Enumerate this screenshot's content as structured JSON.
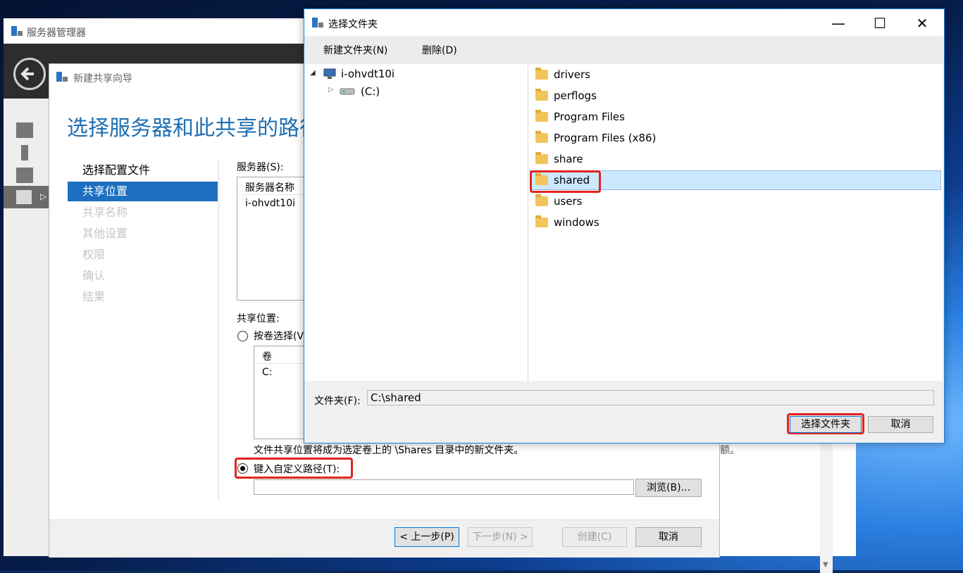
{
  "server_manager": {
    "title": "服务器管理器"
  },
  "wizard": {
    "title": "新建共享向导",
    "heading": "选择服务器和此共享的路径",
    "steps": [
      {
        "label": "选择配置文件",
        "state": "normal"
      },
      {
        "label": "共享位置",
        "state": "selected"
      },
      {
        "label": "共享名称",
        "state": "disabled"
      },
      {
        "label": "其他设置",
        "state": "disabled"
      },
      {
        "label": "权限",
        "state": "disabled"
      },
      {
        "label": "确认",
        "state": "disabled"
      },
      {
        "label": "结果",
        "state": "disabled"
      }
    ],
    "server_label": "服务器(S):",
    "server_col_header": "服务器名称",
    "server_row": "i-ohvdt10i",
    "share_location_label": "共享位置:",
    "radio_by_volume": "按卷选择(V",
    "volume_col_header": "卷",
    "volume_row": "C:",
    "info_text": "文件共享位置将成为选定卷上的 \\Shares 目录中的新文件夹。",
    "info_text_tail": "额。",
    "radio_custom": "键入自定义路径(T):",
    "custom_path_value": "",
    "browse_button": "浏览(B)...",
    "buttons": {
      "prev": "< 上一步(P)",
      "next": "下一步(N) >",
      "create": "创建(C)",
      "cancel": "取消"
    }
  },
  "folder_dialog": {
    "title": "选择文件夹",
    "toolbar": {
      "new_folder": "新建文件夹(N)",
      "delete": "删除(D)"
    },
    "tree": {
      "computer": "i-ohvdt10i",
      "drive": "(C:)"
    },
    "folders": [
      "drivers",
      "perflogs",
      "Program Files",
      "Program Files (x86)",
      "share",
      "shared",
      "users",
      "windows"
    ],
    "selected_folder": "shared",
    "folder_label": "文件夹(F):",
    "folder_value": "C:\\shared",
    "buttons": {
      "select": "选择文件夹",
      "cancel": "取消"
    },
    "window_controls": {
      "minimize": "—",
      "maximize": "☐",
      "close": "✕"
    }
  },
  "colors": {
    "accent": "#1e6fbf",
    "highlight": "#e3231d",
    "selection": "#cce8ff"
  }
}
